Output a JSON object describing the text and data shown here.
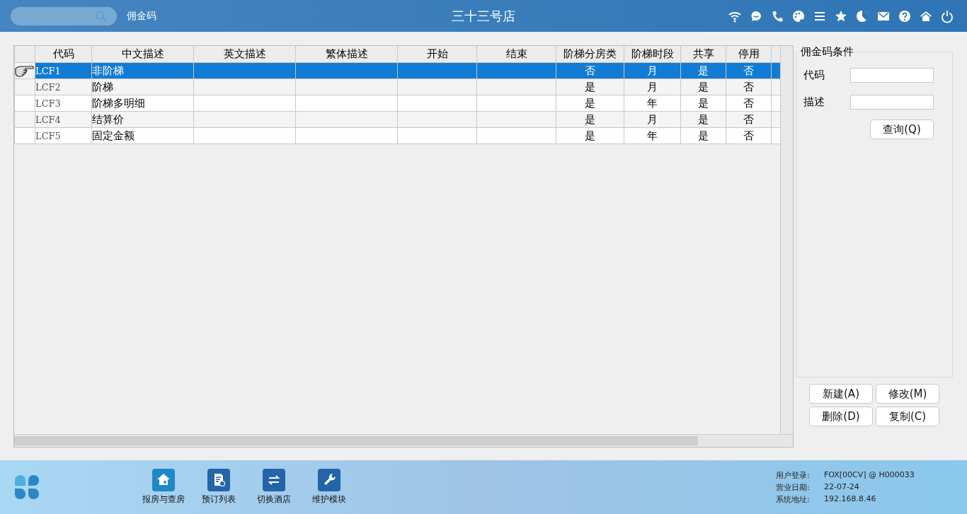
{
  "header": {
    "page_title": "佣金码",
    "store_name": "三十三号店"
  },
  "table": {
    "columns": [
      "代码",
      "中文描述",
      "英文描述",
      "繁体描述",
      "开始",
      "结束",
      "阶梯分房类",
      "阶梯时段",
      "共享",
      "停用"
    ],
    "rows": [
      {
        "selected": true,
        "cells": [
          "LCF1",
          "非阶梯",
          "",
          "",
          "",
          "",
          "否",
          "月",
          "是",
          "否"
        ]
      },
      {
        "selected": false,
        "cells": [
          "LCF2",
          "阶梯",
          "",
          "",
          "",
          "",
          "是",
          "月",
          "是",
          "否"
        ]
      },
      {
        "selected": false,
        "cells": [
          "LCF3",
          "阶梯多明细",
          "",
          "",
          "",
          "",
          "是",
          "年",
          "是",
          "否"
        ]
      },
      {
        "selected": false,
        "cells": [
          "LCF4",
          "结算价",
          "",
          "",
          "",
          "",
          "是",
          "月",
          "是",
          "否"
        ]
      },
      {
        "selected": false,
        "cells": [
          "LCF5",
          "固定金额",
          "",
          "",
          "",
          "",
          "是",
          "年",
          "是",
          "否"
        ]
      }
    ]
  },
  "filter": {
    "title": "佣金码条件",
    "fields": [
      {
        "label": "代码"
      },
      {
        "label": "描述"
      }
    ],
    "query_button": "查询(Q)"
  },
  "actions": [
    "新建(A)",
    "修改(M)",
    "删除(D)",
    "复制(C)"
  ],
  "footer": {
    "shortcuts": [
      {
        "label": "报房与查房"
      },
      {
        "label": "预订列表"
      },
      {
        "label": "切换酒店"
      },
      {
        "label": "维护模块"
      }
    ],
    "info": [
      {
        "label": "用户登录:",
        "value": "FOX[00CV] @ H000033"
      },
      {
        "label": "营业日期:",
        "value": "22-07-24"
      },
      {
        "label": "系统地址:",
        "value": "192.168.8.46"
      }
    ]
  }
}
